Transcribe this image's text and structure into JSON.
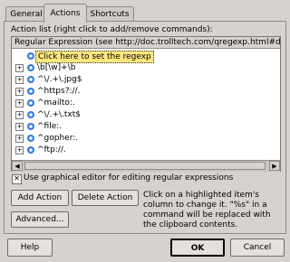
{
  "tabs": [
    {
      "label": "General",
      "active": false
    },
    {
      "label": "Actions",
      "active": true
    },
    {
      "label": "Shortcuts",
      "active": false
    }
  ],
  "action_list_label": "Action list (right click to add/remove commands):",
  "column_header": "Regular Expression (see http://doc.trolltech.com/qregexp.html#details)",
  "rows": [
    {
      "text": "Click here to set the regexp",
      "highlighted": true
    },
    {
      "text": "\\b[\\w]+\\b"
    },
    {
      "text": "^\\/.+\\.jpg$"
    },
    {
      "text": "^https?://."
    },
    {
      "text": "^mailto:."
    },
    {
      "text": "^\\/.+\\.txt$"
    },
    {
      "text": "^file:."
    },
    {
      "text": "^gopher:."
    },
    {
      "text": "^ftp://."
    }
  ],
  "checkbox_checked": true,
  "checkbox_label": "Use graphical editor for editing regular expressions",
  "add_action_label": "Add Action",
  "delete_action_label": "Delete Action",
  "hint_text": "Click on a highlighted item's column to change it. \"%s\" in a command will be replaced with the clipboard contents.",
  "advanced_label": "Advanced...",
  "help_label": "Help",
  "ok_label": "OK",
  "cancel_label": "Cancel",
  "colors": {
    "highlight": "#ffe680",
    "icon": "#3b7bd6"
  }
}
